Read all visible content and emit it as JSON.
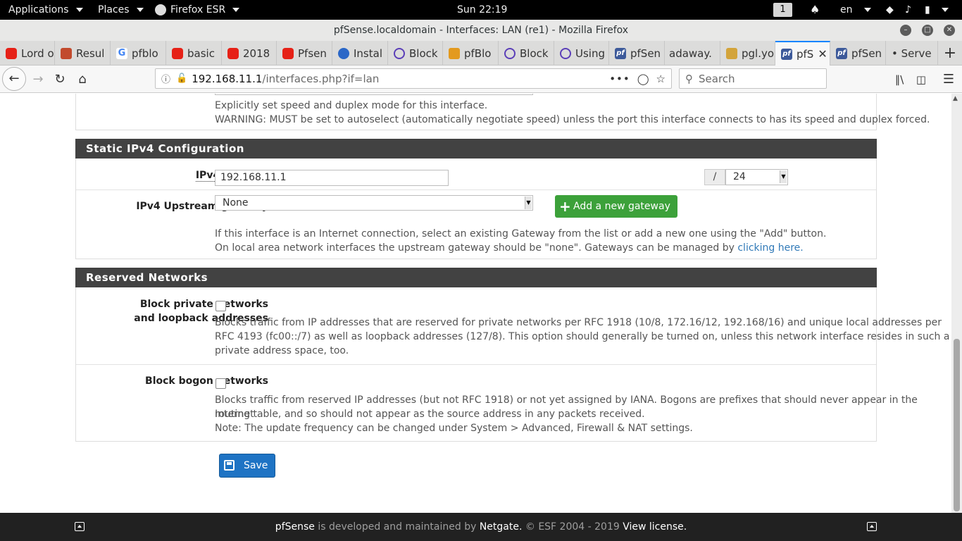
{
  "system_bar": {
    "applications": "Applications",
    "places": "Places",
    "app_name": "Firefox ESR",
    "clock": "Sun 22:19",
    "workspace": "1",
    "language": "en"
  },
  "window": {
    "title": "pfSense.localdomain - Interfaces: LAN (re1) - Mozilla Firefox"
  },
  "tabs": [
    {
      "label": "Lord o",
      "icon": "youtube-icon"
    },
    {
      "label": "Resul",
      "icon": "tool-icon"
    },
    {
      "label": "pfblo",
      "icon": "google-icon"
    },
    {
      "label": "basic",
      "icon": "youtube-icon"
    },
    {
      "label": "2018",
      "icon": "youtube-icon"
    },
    {
      "label": "Pfsen",
      "icon": "youtube-icon"
    },
    {
      "label": "Instal",
      "icon": "lock-icon"
    },
    {
      "label": "Block",
      "icon": "circle-icon"
    },
    {
      "label": "pfBlo",
      "icon": "orange-icon"
    },
    {
      "label": "Block",
      "icon": "circle-icon"
    },
    {
      "label": "Using",
      "icon": "circle-icon"
    },
    {
      "label": "pfSen",
      "icon": "pfsense-icon"
    },
    {
      "label": "adaway.",
      "icon": "none"
    },
    {
      "label": "pgl.yo",
      "icon": "jar-icon"
    },
    {
      "label": "pfS",
      "icon": "pfsense-icon",
      "active": true
    },
    {
      "label": "pfSen",
      "icon": "pfsense-icon"
    },
    {
      "label": "• Serve",
      "icon": "none"
    }
  ],
  "navbar": {
    "url_host": "192.168.11.1",
    "url_path": "/interfaces.php?if=lan",
    "search_placeholder": "Search"
  },
  "top_help": {
    "line1": "Explicitly set speed and duplex mode for this interface.",
    "line2": "WARNING: MUST be set to autoselect (automatically negotiate speed) unless the port this interface connects to has its speed and duplex forced."
  },
  "static_ipv4": {
    "heading": "Static IPv4 Configuration",
    "address_label": "IPv4 Address",
    "address_value": "192.168.11.1",
    "cidr_slash": "/",
    "cidr_value": "24",
    "gateway_label": "IPv4 Upstream gateway",
    "gateway_value": "None",
    "add_gateway_button": "Add a new gateway",
    "help_line1": "If this interface is an Internet connection, select an existing Gateway from the list or add a new one using the \"Add\" button.",
    "help_line2": "On local area network interfaces the upstream gateway should be \"none\". Gateways can be managed by",
    "help_link": "clicking here."
  },
  "reserved": {
    "heading": "Reserved Networks",
    "private_label_1": "Block private networks",
    "private_label_2": "and loopback addresses",
    "private_help_1": "Blocks traffic from IP addresses that are reserved for private networks per RFC 1918 (10/8, 172.16/12, 192.168/16) and unique local addresses per",
    "private_help_2": "RFC 4193 (fc00::/7) as well as loopback addresses (127/8). This option should generally be turned on, unless this network interface resides in such a",
    "private_help_3": "private address space, too.",
    "bogon_label": "Block bogon networks",
    "bogon_help_1": "Blocks traffic from reserved IP addresses (but not RFC 1918) or not yet assigned by IANA. Bogons are prefixes that should never appear in the Internet",
    "bogon_help_2": "routing table, and so should not appear as the source address in any packets received.",
    "bogon_help_3": "Note: The update frequency can be changed under System > Advanced, Firewall & NAT settings."
  },
  "save_button": "Save",
  "footer": {
    "brand": "pfSense",
    "middle": " is developed and maintained by ",
    "company": "Netgate.",
    "copyright": " © ESF 2004 - 2019 ",
    "license": "View license."
  }
}
